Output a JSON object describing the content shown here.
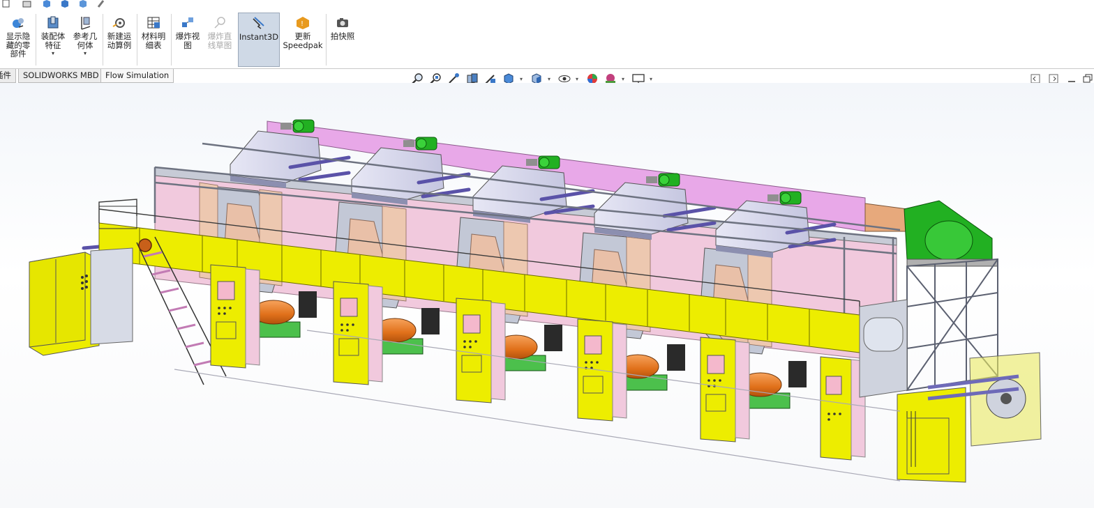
{
  "ribbon": {
    "show_hidden": {
      "label": "显示隐\n藏的零\n部件"
    },
    "assembly_features": {
      "label": "装配体\n特征",
      "dropdown": "▾"
    },
    "reference_geometry": {
      "label": "参考几\n何体",
      "dropdown": "▾"
    },
    "new_motion_study": {
      "label": "新建运\n动算例"
    },
    "bom": {
      "label": "材料明\n细表"
    },
    "exploded_view": {
      "label": "爆炸视\n图"
    },
    "explode_line_sketch": {
      "label": "爆炸直\n线草图"
    },
    "instant3d": {
      "label": "Instant3D"
    },
    "update_speedpak": {
      "label": "更新\nSpeedpak"
    },
    "snapshot": {
      "label": "拍快照"
    }
  },
  "tabs": [
    {
      "label": "插件"
    },
    {
      "label": "SOLIDWORKS MBD"
    },
    {
      "label": "Flow Simulation"
    }
  ],
  "colors": {
    "yellow": "#eded00",
    "pink": "#f1c9dd",
    "magenta_beam": "#e8a8e8",
    "green_motor": "#22b022",
    "orange_roll": "#e87a1e",
    "steel_blue": "#b9c2d8",
    "grey_frame": "#9aa0ac",
    "purple_roller": "#8a82d8"
  },
  "icons": {
    "zoom_fit": "magnifier-icon",
    "zoom_area": "magnifier-area-icon",
    "previous_view": "previous-view-icon",
    "section_view": "section-view-icon",
    "dynamic_annotation": "annotation-icon",
    "view_orientation": "cube-icon",
    "display_style": "shaded-cube-icon",
    "hide_show": "eye-icon",
    "appearance": "appearance-ball-icon",
    "scene": "scene-icon",
    "view_settings": "monitor-icon"
  }
}
